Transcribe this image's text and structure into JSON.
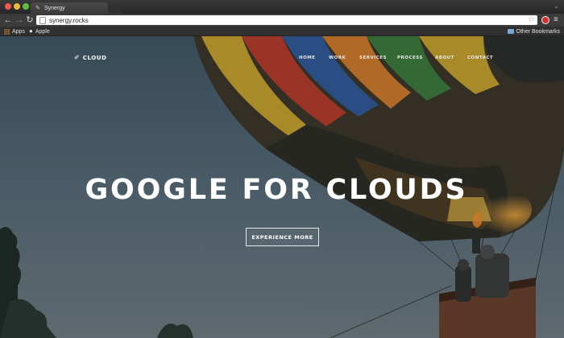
{
  "browser": {
    "tab_title": "Synergy",
    "url": "synergy.rocks",
    "bookmarks": {
      "apps_label": "Apps",
      "apple_label": "Apple",
      "other_label": "Other Bookmarks"
    },
    "icons": {
      "back": "back-arrow-icon",
      "forward": "forward-arrow-icon",
      "reload": "reload-icon",
      "star": "bookmark-star-icon",
      "extension": "extension-icon",
      "menu": "menu-icon"
    }
  },
  "site": {
    "brand": "CLOUD",
    "nav": [
      "HOME",
      "WORK",
      "SERVICES",
      "PROCESS",
      "ABOUT",
      "CONTACT"
    ],
    "headline": "GOOGLE FOR CLOUDS",
    "cta_label": "EXPERIENCE MORE"
  },
  "colors": {
    "accent_red": "#d2332a",
    "headline": "#ffffff"
  }
}
